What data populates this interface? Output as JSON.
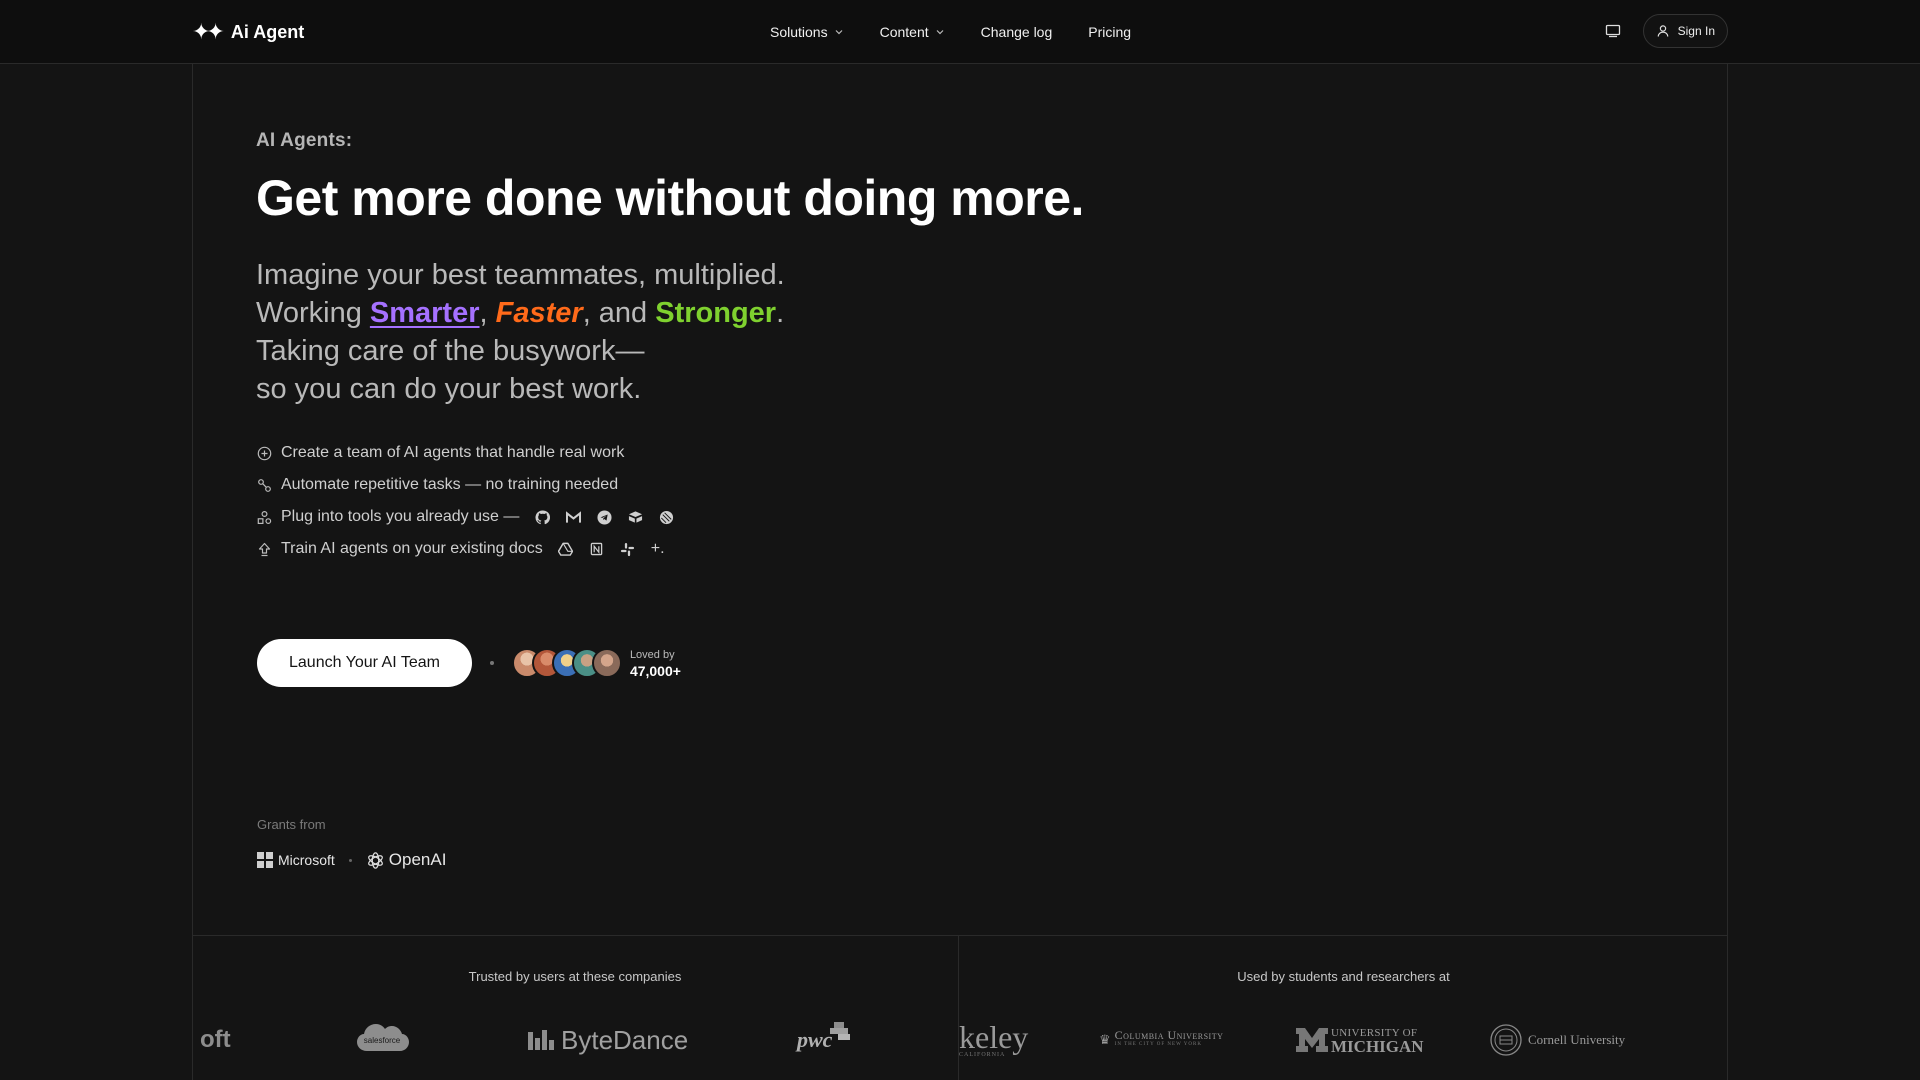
{
  "nav": {
    "brand": "Ai Agent",
    "brand_mark": "✦✦",
    "items": [
      {
        "label": "Solutions",
        "has_dropdown": true
      },
      {
        "label": "Content",
        "has_dropdown": true
      },
      {
        "label": "Change log",
        "has_dropdown": false
      },
      {
        "label": "Pricing",
        "has_dropdown": false
      }
    ],
    "signin_label": "Sign In"
  },
  "hero": {
    "eyebrow": "AI Agents:",
    "headline": "Get more done without doing more.",
    "sub_line1": "Imagine your best teammates, multiplied.",
    "sub_working": "Working ",
    "sub_smarter": "Smarter",
    "sub_comma1": ", ",
    "sub_faster": "Faster",
    "sub_and": ", and ",
    "sub_stronger": "Stronger",
    "sub_period": ".",
    "sub_line3": "Taking care of the busywork—",
    "sub_line4": "so you can do your best work."
  },
  "features": [
    {
      "text": "Create a team of AI agents that handle real work",
      "icon": "plus-circle-icon"
    },
    {
      "text": "Automate repetitive tasks — no training needed",
      "icon": "workflow-icon"
    },
    {
      "text": "Plug into tools you already use —",
      "icon": "shapes-icon",
      "tools": [
        "github-icon",
        "gmail-icon",
        "telegram-icon",
        "airtable-icon",
        "linear-icon"
      ]
    },
    {
      "text": "Train AI agents on your existing docs",
      "icon": "upload-icon",
      "tools": [
        "google-drive-icon",
        "notion-icon",
        "slack-icon"
      ],
      "suffix": "+."
    }
  ],
  "cta": {
    "button_label": "Launch Your AI Team",
    "loved_label": "Loved by",
    "loved_count": "47,000+",
    "avatar_colors": [
      "#c98a6b",
      "#b3573a",
      "#e0b84a",
      "#4a8f86",
      "#8a6a5a"
    ]
  },
  "grants": {
    "label": "Grants from",
    "microsoft": "Microsoft",
    "openai": "OpenAI"
  },
  "trusted": {
    "caption": "Trusted by users at these companies",
    "logos": [
      "oft",
      "salesforce",
      "ByteDance",
      "pwc"
    ]
  },
  "used_by": {
    "caption": "Used by students and researchers at",
    "logos": [
      "keley",
      "Columbia University",
      "University of Michigan",
      "Cornell University"
    ],
    "berkeley_sub": "CALIFORNIA",
    "columbia_sub": "IN THE CITY OF NEW YORK",
    "michigan_top": "UNIVERSITY OF",
    "michigan_bottom": "MICHIGAN"
  },
  "colors": {
    "background": "#141414",
    "smarter": "#a571ff",
    "faster": "#ff6a1a",
    "stronger": "#7fd12f"
  }
}
